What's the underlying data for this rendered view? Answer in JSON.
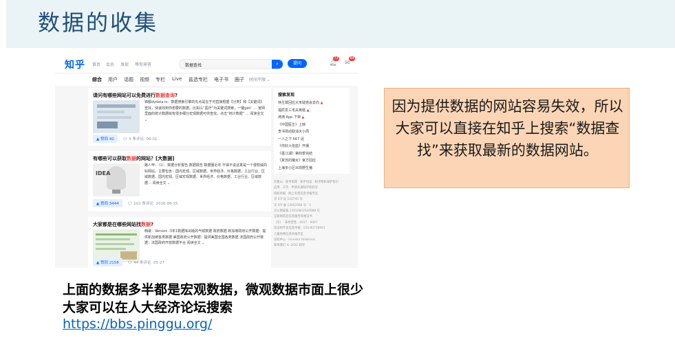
{
  "slide": {
    "title": "数据的收集",
    "callout": "因为提供数据的网站容易失效，所以大家可以直接在知乎上搜索“数据查找”来获取最新的数据网站。",
    "bottom_line1": "上面的数据多半都是宏观数据，微观数据市面上很少",
    "bottom_line2": "大家可以在人大经济论坛搜索",
    "link": "https://bbs.pinggu.org/"
  },
  "zhihu": {
    "logo": "知乎",
    "nav": [
      "首页",
      "会员",
      "发现",
      "等你来答"
    ],
    "search_value": "数据查找",
    "ask_button": "提问",
    "notif_count": "73",
    "msg_count": "44",
    "tabs": [
      "综合",
      "用户",
      "话题",
      "视频",
      "专栏",
      "Live",
      "盐选专栏",
      "电子书",
      "圈子",
      "时间不限 ⌄"
    ],
    "results": [
      {
        "title_plain": "请问有哪些网站可以免费进行",
        "title_hl": "数据查询",
        "title_end": "?",
        "author": "锦都",
        "excerpt": "锦都dydata.io：数据搜索引擎的先点是在于可直接根据【分类】和【关键词】查找，快速找到你想要的数据。比如以“医疗”为关键词搜索，一键get！… 官网里面的统计数据就有很多细分宏观数据可供查找，点击“统计数据” … 阅读全文 ⌄",
        "votes": "赞同 40",
        "comments": "9 条评论",
        "date": "06-01"
      },
      {
        "title_plain": "有哪些可以获取",
        "title_hl": "数据",
        "title_end": "的网站？[大数据]",
        "author": "路人甲",
        "excerpt": "路人甲：（1）、数据分析报告 数据报告 数据圈近年 不得不说这真是一个很权威的好网站，主要包含：国内宏观、区域数据、世界经济、价格数据、工业行业、区域数据、国内宏观、区域宏观数据、世界经济、价格数据、工业行业、区域数据… 阅读全文 ⌄",
        "votes": "赞同 3444",
        "comments": "102 条评论",
        "date": "2016-08-15"
      },
      {
        "title_plain": "大家都是在哪些网站找",
        "title_hl": "数据",
        "title_end": "?",
        "author": "韩歌",
        "excerpt": "韩歌：Version -3年1数据库出版的气候数据 政府数据 新加坡政府公开数据：提供新加坡各类数据 美国政府公开数据：提供美国全国各类数据 法国政府公开数据：法国政府开放数据平台 阅读全文 ⌄",
        "votes": "赞同 2158",
        "comments": "44 条评论",
        "date": "05-27"
      }
    ],
    "sidebar_title": "搜索发现",
    "sidebar_items": [
      {
        "text": "林生斌回应大宋疑惑会去向",
        "hot": true
      },
      {
        "text": "福原爱三宅夫离婚",
        "hot": true
      },
      {
        "text": "滴滴 App 下架",
        "hot": true
      },
      {
        "text": "《中国医生》上映",
        "hot": false
      },
      {
        "text": "李书扬动取消大小周",
        "hot": false
      },
      {
        "text": "一人之下 567 话",
        "hot": false
      },
      {
        "text": "《你好火焰蓝》开播",
        "hot": false
      },
      {
        "text": "《墨江湖》第四季完结",
        "hot": false
      },
      {
        "text": "《复苏的魔女》官方回应",
        "hot": false
      },
      {
        "text": "上海多小区出现野生猪",
        "hot": false
      }
    ],
    "footer": [
      "刘看山 · 知乎指南 · 知乎协议 · 知乎隐私保护指引",
      "应用 · 工作 · 申请开通知乎机构号",
      "侵权举报 · 网上有害信息举报专区",
      "京 ICP 证 110745 号",
      "京 ICP 备 13052560 号 - 1",
      "京公网安备 11010802020088 号",
      "互联网药品信息服务资格证书",
      "（京）- 非经营性 - 2017 - 0067",
      "违法和不良信息举报：010-82716601",
      "儿童色情信息举报专区",
      "证照中心 · Investor Relations",
      "联系我们 © 2021 知乎"
    ]
  }
}
